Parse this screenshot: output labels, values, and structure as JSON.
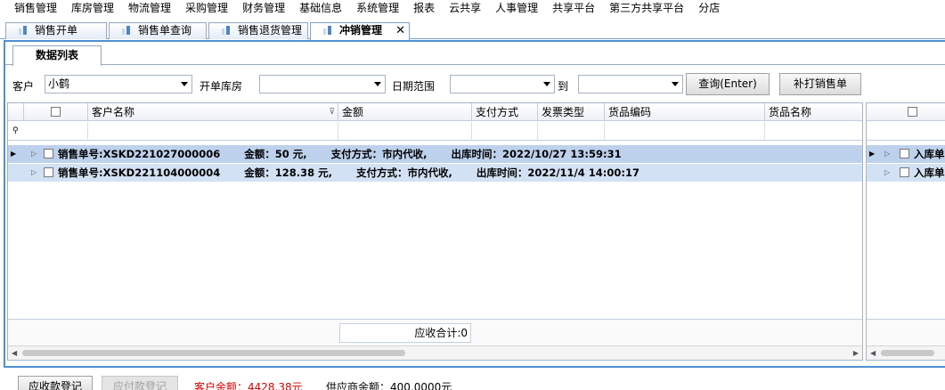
{
  "menu": [
    "销售管理",
    "库房管理",
    "物流管理",
    "采购管理",
    "财务管理",
    "基础信息",
    "系统管理",
    "报表",
    "云共享",
    "人事管理",
    "共享平台",
    "第三方共享平台",
    "分店"
  ],
  "doc_tabs": [
    {
      "label": "销售开单"
    },
    {
      "label": "销售单查询"
    },
    {
      "label": "销售退货管理"
    },
    {
      "label": "冲销管理",
      "close": "✕"
    }
  ],
  "sub_tab": "数据列表",
  "filter": {
    "customer_label": "客户",
    "customer_value": "小鹤",
    "warehouse_label": "开单库房",
    "warehouse_value": "",
    "date_label": "日期范围",
    "date_from": "",
    "to_label": "到",
    "date_to": "",
    "query_button": "查询(Enter)",
    "reprint_button": "补打销售单"
  },
  "grid": {
    "columns": [
      "客户名称",
      "金额",
      "支付方式",
      "发票类型",
      "货品编码",
      "货品名称"
    ],
    "rows": [
      {
        "text": "销售单号:XSKD221027000006　　 金额：50 元,　　 支付方式：市内代收,　　 出库时间：2022/10/27 13:59:31"
      },
      {
        "text": "销售单号:XSKD221104000004　　 金额：128.38 元,　　 支付方式：市内代收,　　 出库时间：2022/11/4 14:00:17"
      }
    ],
    "summary": "应收合计:0"
  },
  "side_grid": {
    "rows": [
      {
        "text": "入库单"
      },
      {
        "text": "入库单"
      }
    ]
  },
  "bottom": {
    "receivable_button": "应收款登记",
    "payable_button": "应付款登记",
    "customer_balance": "客户余额：4428.38元",
    "supplier_balance": "供应商余额：400.0000元"
  },
  "colors": {
    "accent": "#4f8fd3",
    "selected_row": "#bed1ec",
    "balance_red": "#d40000"
  }
}
